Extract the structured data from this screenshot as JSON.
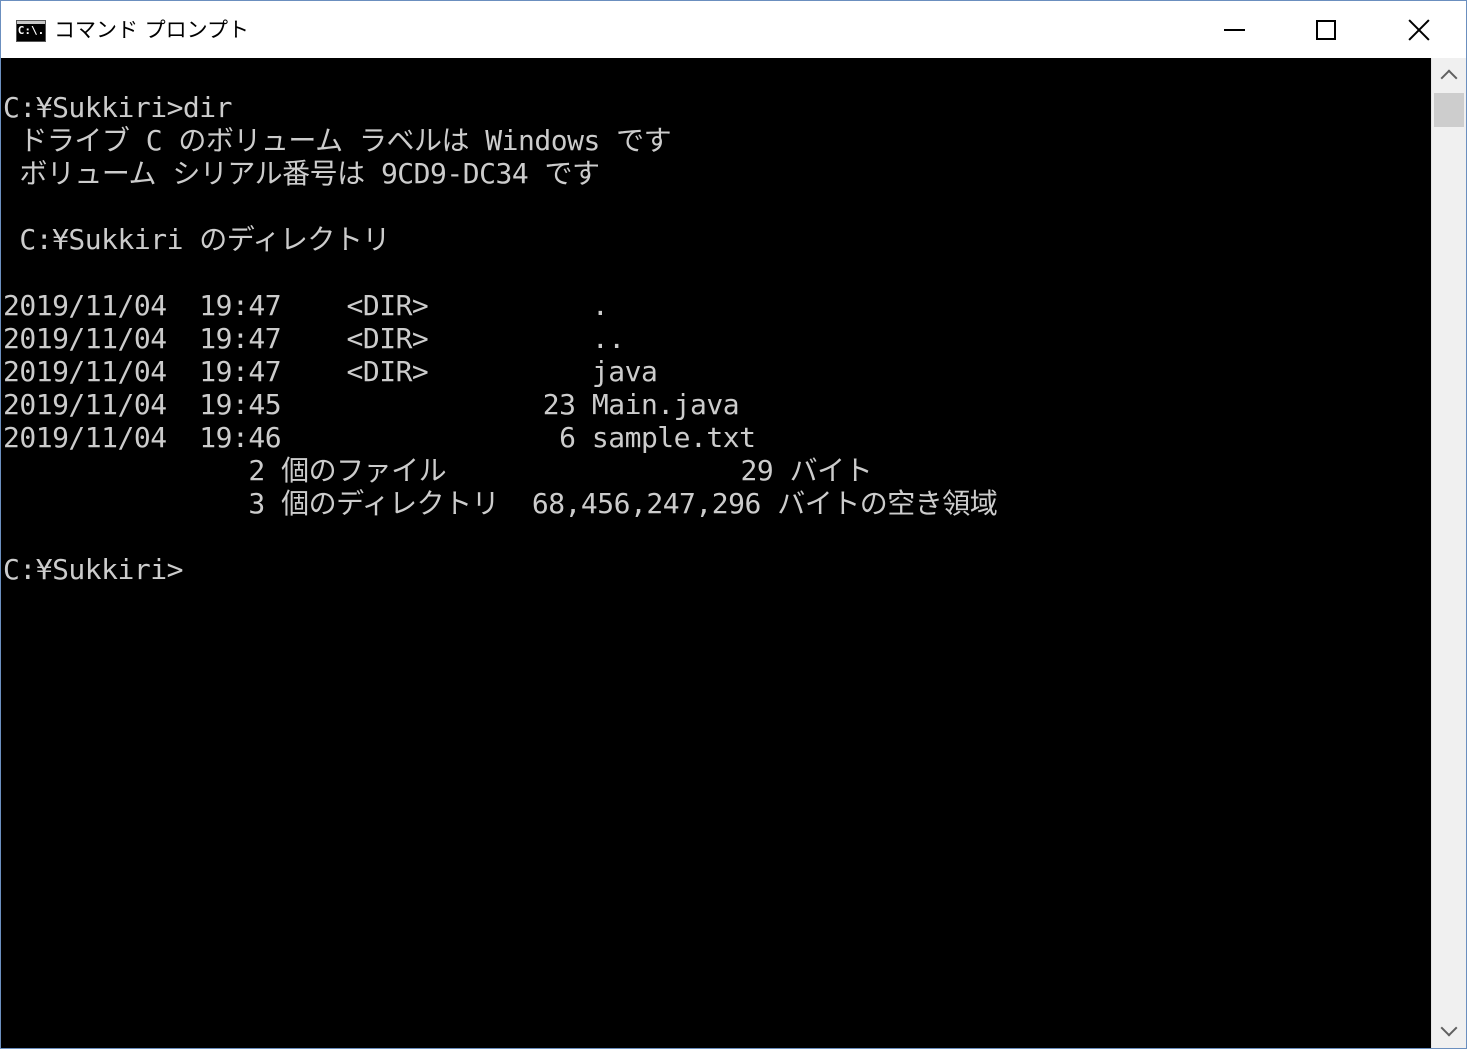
{
  "window": {
    "icon_label": "C:\\.",
    "title": "コマンド プロンプト"
  },
  "console": {
    "lines": [
      "C:¥Sukkiri>dir",
      " ドライブ C のボリューム ラベルは Windows です",
      " ボリューム シリアル番号は 9CD9-DC34 です",
      "",
      " C:¥Sukkiri のディレクトリ",
      "",
      "2019/11/04  19:47    <DIR>          .",
      "2019/11/04  19:47    <DIR>          ..",
      "2019/11/04  19:47    <DIR>          java",
      "2019/11/04  19:45                23 Main.java",
      "2019/11/04  19:46                 6 sample.txt",
      "               2 個のファイル                  29 バイト",
      "               3 個のディレクトリ  68,456,247,296 バイトの空き領域",
      "",
      "C:¥Sukkiri>"
    ]
  }
}
